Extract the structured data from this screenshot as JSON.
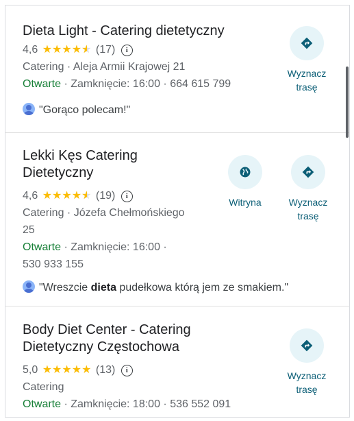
{
  "results": [
    {
      "title": "Dieta Light - Catering dietetyczny",
      "rating": "4,6",
      "stars": "★★★★",
      "reviews_count": "(17)",
      "category_address": "Catering · Aleja Armii Krajowej 21",
      "status": "Otwarte",
      "hours_phone": " · Zamknięcie: 16:00 · 664 615 799",
      "review_text": "\"Gorąco polecam!\"",
      "directions_label_1": "Wyznacz",
      "directions_label_2": "trasę"
    },
    {
      "title_line1": "Lekki Kęs Catering",
      "title_line2": "Dietetyczny",
      "rating": "4,6",
      "stars": "★★★★",
      "reviews_count": "(19)",
      "category_address_1": "Catering · Józefa Chełmońskiego",
      "category_address_2": "25",
      "status": "Otwarte",
      "hours": " · Zamknięcie: 16:00 ·",
      "phone": "530 933 155",
      "review_before": "\"Wreszcie ",
      "review_bold": "dieta",
      "review_after": " pudełkowa którą jem ze smakiem.\"",
      "website_label": "Witryna",
      "directions_label_1": "Wyznacz",
      "directions_label_2": "trasę"
    },
    {
      "title_line1": "Body Diet Center - Catering",
      "title_line2": "Dietetyczny Częstochowa",
      "rating": "5,0",
      "stars": "★★★★★",
      "reviews_count": "(13)",
      "category": "Catering",
      "status": "Otwarte",
      "hours_phone": " · Zamknięcie: 18:00 · 536 552 091",
      "directions_label_1": "Wyznacz",
      "directions_label_2": "trasę"
    }
  ],
  "colors": {
    "accent": "#0b5e76",
    "open": "#188038",
    "star": "#fbbc04",
    "button_bg": "#e6f4f8"
  },
  "icons": {
    "directions": "directions-icon",
    "website": "globe-icon",
    "info": "info-icon",
    "avatar": "avatar-icon"
  }
}
